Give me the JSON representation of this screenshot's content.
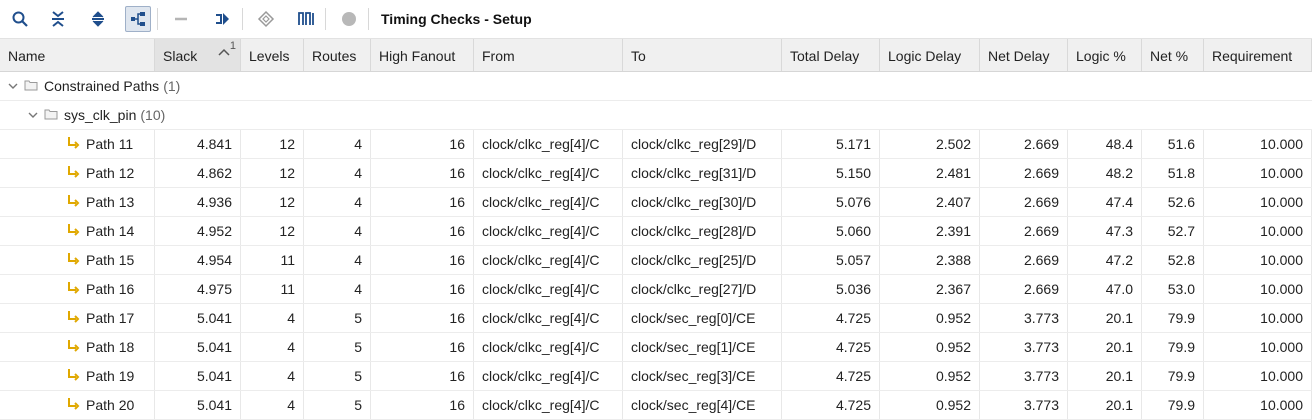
{
  "toolbar": {
    "title": "Timing Checks - Setup",
    "icons": [
      "search-icon",
      "collapse-all-icon",
      "expand-all-icon",
      "hierarchy-icon",
      "minus-icon",
      "schematic-icon",
      "diamond-icon",
      "waveform-icon",
      "circle-icon"
    ]
  },
  "columns": {
    "name": "Name",
    "slack": "Slack",
    "slack_sort": "1",
    "levels": "Levels",
    "routes": "Routes",
    "high_fanout": "High Fanout",
    "from": "From",
    "to": "To",
    "total_delay": "Total Delay",
    "logic_delay": "Logic Delay",
    "net_delay": "Net Delay",
    "logic_pct": "Logic %",
    "net_pct": "Net %",
    "requirement": "Requirement"
  },
  "groups": {
    "constrained": {
      "label": "Constrained Paths",
      "count": "(1)"
    },
    "clock": {
      "label": "sys_clk_pin",
      "count": "(10)"
    }
  },
  "rows": [
    {
      "name": "Path 11",
      "slack": "4.841",
      "levels": "12",
      "routes": "4",
      "fanout": "16",
      "from": "clock/clkc_reg[4]/C",
      "to": "clock/clkc_reg[29]/D",
      "total": "5.171",
      "logic": "2.502",
      "net": "2.669",
      "logic_pct": "48.4",
      "net_pct": "51.6",
      "req": "10.000"
    },
    {
      "name": "Path 12",
      "slack": "4.862",
      "levels": "12",
      "routes": "4",
      "fanout": "16",
      "from": "clock/clkc_reg[4]/C",
      "to": "clock/clkc_reg[31]/D",
      "total": "5.150",
      "logic": "2.481",
      "net": "2.669",
      "logic_pct": "48.2",
      "net_pct": "51.8",
      "req": "10.000"
    },
    {
      "name": "Path 13",
      "slack": "4.936",
      "levels": "12",
      "routes": "4",
      "fanout": "16",
      "from": "clock/clkc_reg[4]/C",
      "to": "clock/clkc_reg[30]/D",
      "total": "5.076",
      "logic": "2.407",
      "net": "2.669",
      "logic_pct": "47.4",
      "net_pct": "52.6",
      "req": "10.000"
    },
    {
      "name": "Path 14",
      "slack": "4.952",
      "levels": "12",
      "routes": "4",
      "fanout": "16",
      "from": "clock/clkc_reg[4]/C",
      "to": "clock/clkc_reg[28]/D",
      "total": "5.060",
      "logic": "2.391",
      "net": "2.669",
      "logic_pct": "47.3",
      "net_pct": "52.7",
      "req": "10.000"
    },
    {
      "name": "Path 15",
      "slack": "4.954",
      "levels": "11",
      "routes": "4",
      "fanout": "16",
      "from": "clock/clkc_reg[4]/C",
      "to": "clock/clkc_reg[25]/D",
      "total": "5.057",
      "logic": "2.388",
      "net": "2.669",
      "logic_pct": "47.2",
      "net_pct": "52.8",
      "req": "10.000"
    },
    {
      "name": "Path 16",
      "slack": "4.975",
      "levels": "11",
      "routes": "4",
      "fanout": "16",
      "from": "clock/clkc_reg[4]/C",
      "to": "clock/clkc_reg[27]/D",
      "total": "5.036",
      "logic": "2.367",
      "net": "2.669",
      "logic_pct": "47.0",
      "net_pct": "53.0",
      "req": "10.000"
    },
    {
      "name": "Path 17",
      "slack": "5.041",
      "levels": "4",
      "routes": "5",
      "fanout": "16",
      "from": "clock/clkc_reg[4]/C",
      "to": "clock/sec_reg[0]/CE",
      "total": "4.725",
      "logic": "0.952",
      "net": "3.773",
      "logic_pct": "20.1",
      "net_pct": "79.9",
      "req": "10.000"
    },
    {
      "name": "Path 18",
      "slack": "5.041",
      "levels": "4",
      "routes": "5",
      "fanout": "16",
      "from": "clock/clkc_reg[4]/C",
      "to": "clock/sec_reg[1]/CE",
      "total": "4.725",
      "logic": "0.952",
      "net": "3.773",
      "logic_pct": "20.1",
      "net_pct": "79.9",
      "req": "10.000"
    },
    {
      "name": "Path 19",
      "slack": "5.041",
      "levels": "4",
      "routes": "5",
      "fanout": "16",
      "from": "clock/clkc_reg[4]/C",
      "to": "clock/sec_reg[3]/CE",
      "total": "4.725",
      "logic": "0.952",
      "net": "3.773",
      "logic_pct": "20.1",
      "net_pct": "79.9",
      "req": "10.000"
    },
    {
      "name": "Path 20",
      "slack": "5.041",
      "levels": "4",
      "routes": "5",
      "fanout": "16",
      "from": "clock/clkc_reg[4]/C",
      "to": "clock/sec_reg[4]/CE",
      "total": "4.725",
      "logic": "0.952",
      "net": "3.773",
      "logic_pct": "20.1",
      "net_pct": "79.9",
      "req": "10.000"
    }
  ],
  "colors": {
    "accent": "#1f4e8c",
    "path_icon": "#e0a800",
    "header_bg": "#f0f0f0"
  }
}
